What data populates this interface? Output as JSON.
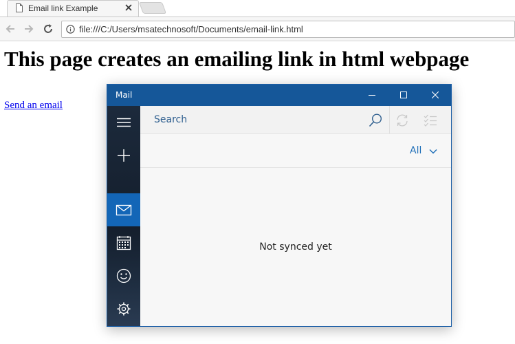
{
  "browser": {
    "tab_title": "Email link Example",
    "url": "file:///C:/Users/msatechnosoft/Documents/email-link.html"
  },
  "page": {
    "heading": "This page creates an emailing link in html webpage",
    "link_text": "Send an email"
  },
  "mail": {
    "title": "Mail",
    "search_placeholder": "Search",
    "filter_label": "All",
    "empty_message": "Not synced yet",
    "nav_icons": [
      "hamburger-icon",
      "plus-icon",
      "mail-icon",
      "calendar-icon",
      "smiley-icon",
      "gear-icon"
    ],
    "active_nav": "mail-icon",
    "accent_color": "#155799",
    "active_color": "#1366b7"
  }
}
